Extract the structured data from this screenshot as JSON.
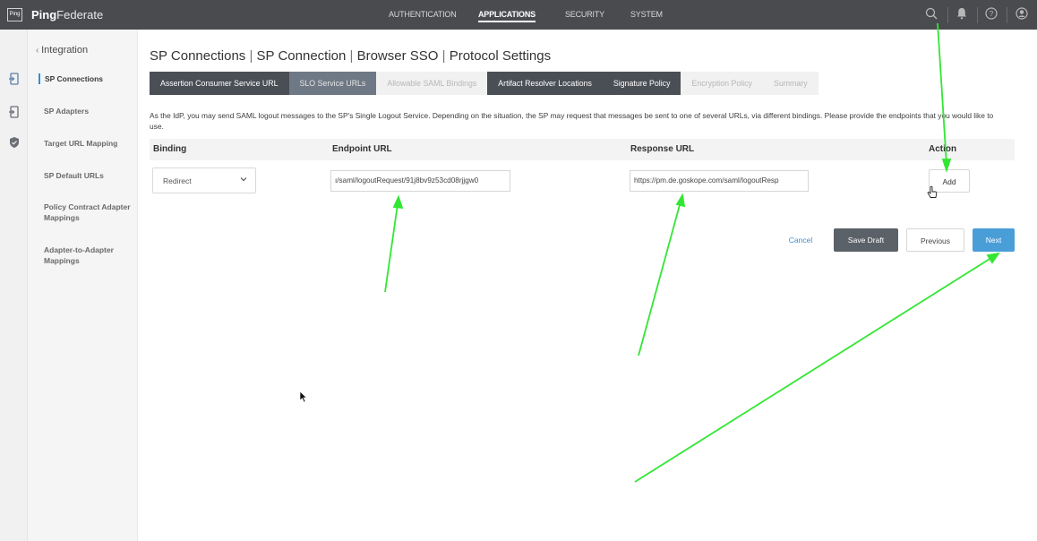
{
  "brand": {
    "logo_text": "Ping",
    "name_bold": "Ping",
    "name_rest": "Federate"
  },
  "topnav": {
    "authentication": "AUTHENTICATION",
    "applications": "APPLICATIONS",
    "security": "SECURITY",
    "system": "SYSTEM"
  },
  "topbar_icons": [
    "search-icon",
    "bell-icon",
    "help-icon",
    "user-icon"
  ],
  "sidebar": {
    "back_label": "Integration",
    "items": [
      {
        "label": "SP Connections",
        "active": true
      },
      {
        "label": "SP Adapters"
      },
      {
        "label": "Target URL Mapping"
      },
      {
        "label": "SP Default URLs"
      },
      {
        "label": "Policy Contract Adapter Mappings"
      },
      {
        "label": "Adapter-to-Adapter Mappings"
      }
    ]
  },
  "breadcrumb": {
    "part1": "SP Connections",
    "part2": "SP Connection",
    "part3": "Browser SSO",
    "part4": "Protocol Settings",
    "separator": "|"
  },
  "tabs": [
    {
      "label": "Assertion Consumer Service URL",
      "state": "dark"
    },
    {
      "label": "SLO Service URLs",
      "state": "active"
    },
    {
      "label": "Allowable SAML Bindings",
      "state": "disabled"
    },
    {
      "label": "Artifact Resolver Locations",
      "state": "dark"
    },
    {
      "label": "Signature Policy",
      "state": "dark"
    },
    {
      "label": "Encryption Policy",
      "state": "disabled"
    },
    {
      "label": "Summary",
      "state": "disabled"
    }
  ],
  "description": "As the IdP, you may send SAML logout messages to the SP's Single Logout Service. Depending on the situation, the SP may request that messages be sent to one of several URLs, via different bindings. Please provide the endpoints that you would like to use.",
  "table": {
    "headers": {
      "binding": "Binding",
      "endpoint": "Endpoint URL",
      "response": "Response URL",
      "action": "Action"
    },
    "row": {
      "binding": "Redirect",
      "endpoint": "ı/saml/logoutRequest/91j8bv9z53cd08rjjgw0",
      "response": "https://pm.de.goskope.com/saml/logoutResp",
      "action": "Add"
    }
  },
  "buttons": {
    "cancel": "Cancel",
    "save_draft": "Save Draft",
    "previous": "Previous",
    "next": "Next"
  },
  "colors": {
    "topbar": "#4a4b4f",
    "primary": "#4a9ed8",
    "dark_button": "#5b6169",
    "annotation_arrow": "#33e633"
  }
}
